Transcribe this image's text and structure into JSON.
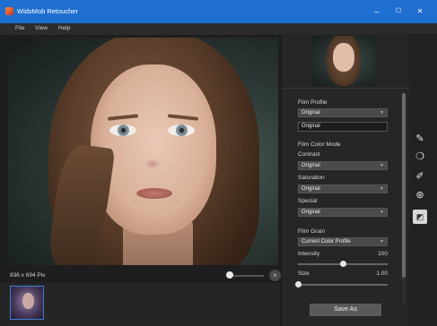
{
  "window": {
    "title": "WidsMob Retoucher",
    "minimize": "–",
    "maximize": "☐",
    "close": "✕"
  },
  "menu": {
    "items": [
      "File",
      "View",
      "Help"
    ]
  },
  "canvas": {
    "dimensions": "836 x 694 Pix",
    "zoom_fit_label": "fit"
  },
  "panel": {
    "film_profile": {
      "label": "Film Profile",
      "dropdown_value": "Original",
      "field_value": "Original"
    },
    "film_color_mode": {
      "label": "Film Color Mode",
      "contrast": {
        "label": "Contrast",
        "value": "Original"
      },
      "saturation": {
        "label": "Saturation",
        "value": "Original"
      },
      "special": {
        "label": "Special",
        "value": "Original"
      }
    },
    "film_grain": {
      "label": "Film Grain",
      "profile_value": "Current Color Profile",
      "intensity": {
        "label": "Intensity",
        "value": "100",
        "fraction": 0.5
      },
      "size": {
        "label": "Size",
        "value": "1.00",
        "fraction": 0.0
      }
    },
    "save_label": "Save As"
  },
  "toolbar": {
    "tools": [
      "pencil-icon",
      "droplet-icon",
      "brush-icon",
      "color-circles-icon",
      "film-icon"
    ]
  }
}
